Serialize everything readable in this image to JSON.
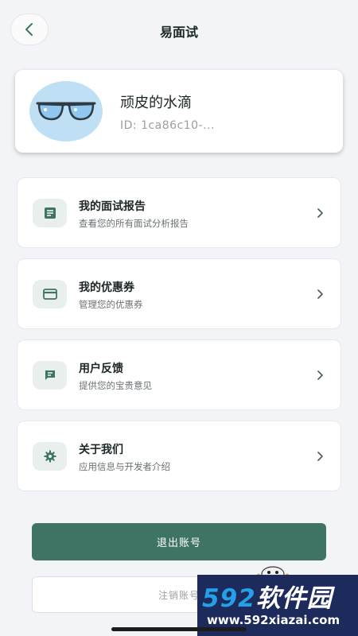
{
  "header": {
    "title": "易面试"
  },
  "profile": {
    "name": "顽皮的水滴",
    "id": "ID: 1ca86c10-..."
  },
  "menu": [
    {
      "title": "我的面试报告",
      "subtitle": "查看您的所有面试分析报告",
      "icon": "report-icon"
    },
    {
      "title": "我的优惠券",
      "subtitle": "管理您的优惠券",
      "icon": "coupon-card-icon"
    },
    {
      "title": "用户反馈",
      "subtitle": "提供您的宝贵意见",
      "icon": "feedback-chat-icon"
    },
    {
      "title": "关于我们",
      "subtitle": "应用信息与开发者介绍",
      "icon": "gear-icon"
    }
  ],
  "actions": {
    "logout": "退出账号",
    "delete": "注销账号"
  },
  "watermark": {
    "brand_num": "592",
    "brand_text": "软件园",
    "url": "www.592xiazai.com"
  },
  "colors": {
    "accent": "#3f7465",
    "background": "#f3f4f7",
    "icon_bg": "#e9efed"
  }
}
